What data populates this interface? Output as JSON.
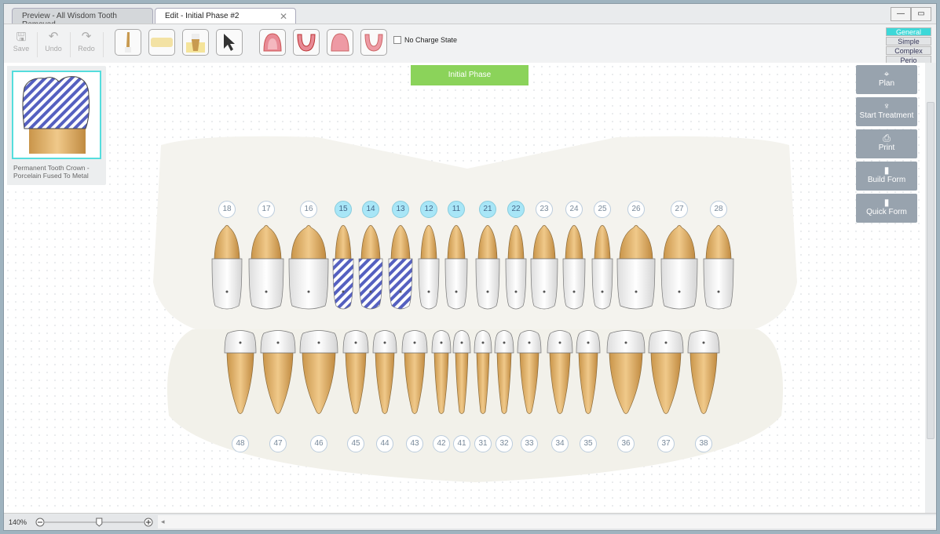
{
  "tabs": [
    {
      "label": "Preview - All Wisdom Tooth Removed",
      "active": false
    },
    {
      "label": "Edit - Initial Phase #2",
      "active": true
    }
  ],
  "toolbar": {
    "save": "Save",
    "undo": "Undo",
    "redo": "Redo",
    "no_charge_state": "No Charge State",
    "no_charge_checked": false
  },
  "modes": [
    {
      "label": "General",
      "active": true
    },
    {
      "label": "Simple"
    },
    {
      "label": "Complex"
    },
    {
      "label": "Perio"
    }
  ],
  "phase_label": "Initial Phase",
  "preview": {
    "caption": "Permanent Tooth Crown -Porcelain Fused To Metal"
  },
  "actions": [
    {
      "label": "Plan",
      "icon": "crosshair-icon"
    },
    {
      "label": "Start Treatment",
      "icon": "tooth-icon"
    },
    {
      "label": "Print",
      "icon": "printer-icon"
    },
    {
      "label": "Build Form",
      "icon": "clipboard-icon"
    },
    {
      "label": "Quick Form",
      "icon": "clipboard-icon"
    }
  ],
  "upper_teeth": [
    "18",
    "17",
    "16",
    "15",
    "14",
    "13",
    "12",
    "11",
    "21",
    "22",
    "23",
    "24",
    "25",
    "26",
    "27",
    "28"
  ],
  "lower_teeth": [
    "48",
    "47",
    "46",
    "45",
    "44",
    "43",
    "42",
    "41",
    "31",
    "32",
    "33",
    "34",
    "35",
    "36",
    "37",
    "38"
  ],
  "highlighted_teeth": [
    "15",
    "14",
    "13",
    "12",
    "11",
    "21",
    "22"
  ],
  "crowned_teeth": [
    "15",
    "14",
    "13"
  ],
  "zoom": {
    "label": "140%",
    "slider_fraction": 0.55
  },
  "colors": {
    "accent": "#3dd8d8",
    "phase": "#8bd35a",
    "crown_stripe": "#5560c0",
    "root": "#deb06a",
    "highlight": "#a8e6f7"
  }
}
